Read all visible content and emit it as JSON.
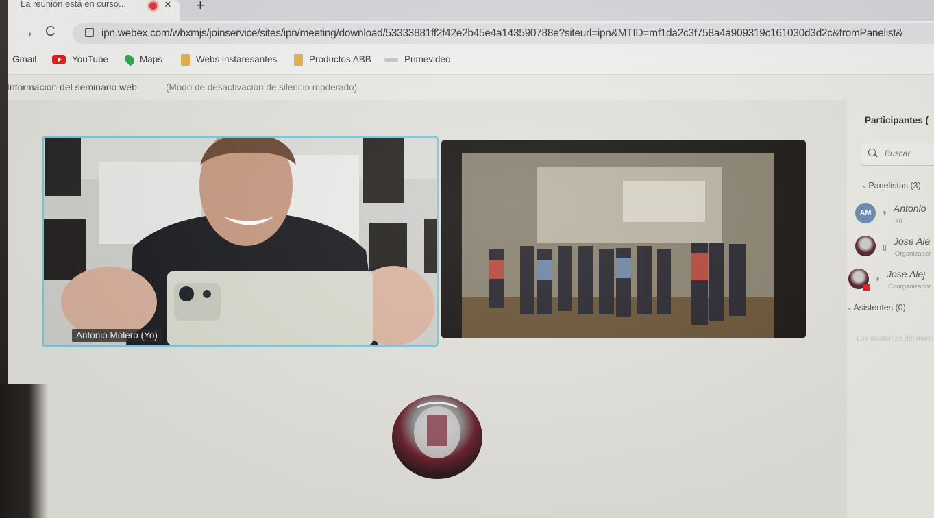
{
  "tab": {
    "title": "La reunión está en curso...",
    "close": "×",
    "new_tab": "+"
  },
  "toolbar": {
    "forward": "→",
    "reload": "C",
    "url": "ipn.webex.com/wbxmjs/joinservice/sites/ipn/meeting/download/53333881ff2f42e2b45e4a143590788e?siteurl=ipn&MTID=mf1da2c3f758a4a909319c161030d3d2c&fromPanelist&"
  },
  "bookmarks": [
    {
      "label": "Gmail",
      "icon": "gmail-icon"
    },
    {
      "label": "YouTube",
      "icon": "youtube-icon"
    },
    {
      "label": "Maps",
      "icon": "maps-icon"
    },
    {
      "label": "Webs instaresantes",
      "icon": "folder-icon"
    },
    {
      "label": "Productos ABB",
      "icon": "folder-icon"
    },
    {
      "label": "Primevideo",
      "icon": "primevideo-icon"
    }
  ],
  "infobar": {
    "title": "Información del seminario web",
    "mode": "(Modo de desactivación de silencio moderado)"
  },
  "videos": {
    "self_name": "Antonio Molero (Yo)"
  },
  "participants": {
    "title": "Participantes (",
    "search_placeholder": "Buscar",
    "panelists_label": "Panelistas (3)",
    "attendees_label": "Asistentes (0)",
    "faded_text": "Los asistentes del meeting",
    "items": [
      {
        "initials": "AM",
        "name": "Antonio",
        "role": "Yo"
      },
      {
        "initials": "",
        "name": "Jose Ale",
        "role": "Organizador"
      },
      {
        "initials": "",
        "name": "Jose Alej",
        "role": "Coorganizador"
      }
    ]
  },
  "colors": {
    "active_border": "#7ec9d8",
    "recording": "#e53935",
    "avatar_am": "#6d8bb5"
  }
}
